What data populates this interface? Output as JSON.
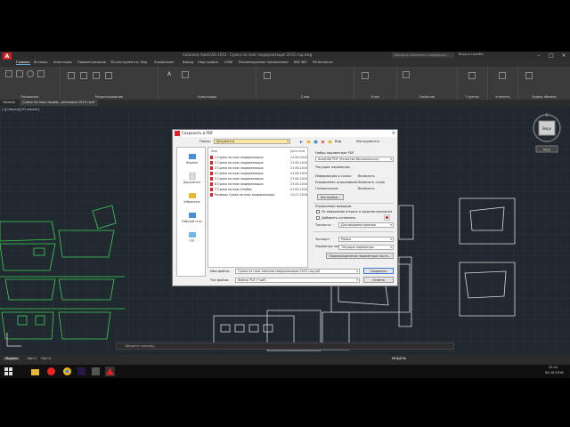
{
  "app": {
    "title": "Autodesk AutoCAD 2015 · Сумка на пояс модернизация 2015 год.dwg",
    "search_placeholder": "Введите ключевое слово/фразу",
    "signin": "Вход в службы",
    "logo": "A"
  },
  "ribbon_tabs": [
    "Главная",
    "Вставка",
    "Аннотации",
    "Параметризация",
    "3D-инструменты",
    "Вид",
    "Управление",
    "Вывод",
    "Надстройки",
    "A360",
    "Рекомендуемые приложения",
    "BIM 360",
    "Performance"
  ],
  "ribbon_groups": [
    "Рисование",
    "Редактирование",
    "Аннотации",
    "Слои",
    "Блок",
    "Свойства",
    "Группы",
    "Утилиты",
    "Буфер обмена"
  ],
  "doc_tabs": [
    "Начало",
    "Сумка на пояс модер...рнизация 2015 год*"
  ],
  "view_label": "[-][Сверху][2D-каркас]",
  "viewcube": {
    "north": "С",
    "face": "Верх",
    "wcs": "МСК"
  },
  "command_placeholder": "Введите команду",
  "status": {
    "tabs": [
      "Модель",
      "Лист1",
      "Лист2"
    ],
    "mode": "МОДЕЛЬ"
  },
  "taskbar": {
    "time": "22:12",
    "date": "05.10.2016"
  },
  "dialog": {
    "title": "Сохранить в PDF",
    "folder_label": "Папка:",
    "folder_value": "Документы",
    "places": [
      "Журнал",
      "Документы",
      "Избранное",
      "Рабочий стол",
      "FTP"
    ],
    "list_headers": {
      "name": "Имя",
      "date": "Дата изм"
    },
    "files": [
      {
        "name": "1 Сумка на пояс модернизация",
        "date": "23.08.2016"
      },
      {
        "name": "2 Сумка на пояс модернизация",
        "date": "23.08.2016"
      },
      {
        "name": "3 Сумка на пояс модернизация",
        "date": "23.08.2016"
      },
      {
        "name": "4 Сумка на пояс модернизация",
        "date": "23.08.2016"
      },
      {
        "name": "5 Сумка на пояс модернизация",
        "date": "23.08.2016"
      },
      {
        "name": "6 Сумка на пояс модернизация",
        "date": "23.08.2016"
      },
      {
        "name": "7 Сумка на пояс Ильбек",
        "date": "07.09.2016"
      },
      {
        "name": "Размеры Сумка на пояс модернизация",
        "date": "22.07.2016"
      }
    ],
    "toolbar": {
      "views": "Вид",
      "tools": "Инструменты"
    },
    "pdf_preset_label": "Набор параметров PDF",
    "pdf_preset_value": "AutoCAD PDF (Качество бесконечного)",
    "current_params_label": "Текущие параметры",
    "params": [
      {
        "k": "Информация о слоях:",
        "v": "Включить"
      },
      {
        "k": "Управление штриховкой:",
        "v": "Заменить строк"
      },
      {
        "k": "Гиперссылки:",
        "v": "Включить"
      }
    ],
    "options_button": "Настройки...",
    "output_label": "Управление выводом",
    "open_in_viewer": "По завершении открыть в средстве просмотра",
    "add_stamp": "Добавить штемпель",
    "precision_label": "Точность:",
    "precision_value": "Для машиностроения",
    "export_label": "Экспорт:",
    "export_value": "Рамка",
    "sheet_params_label": "Параметры листа:",
    "sheet_params_value": "Текущие параметры",
    "override_button": "Переопределение параметров листа...",
    "filename_label": "Имя файла:",
    "filename_value": "Сумка на пояс поясная модернизация 2015 год.pdf",
    "filetype_label": "Тип файла:",
    "filetype_value": "Файлы PDF (*.pdf)",
    "save_button": "Сохранить",
    "cancel_button": "Отмена"
  }
}
